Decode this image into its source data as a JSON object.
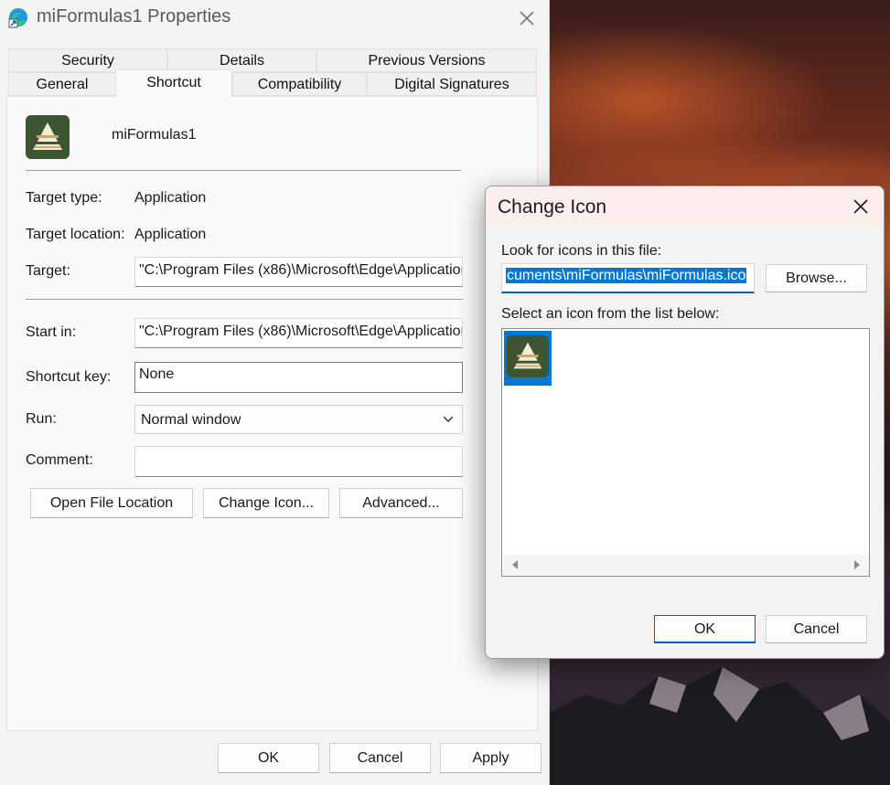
{
  "properties": {
    "title": "miFormulas1 Properties",
    "tabs_row1": [
      "Security",
      "Details",
      "Previous Versions"
    ],
    "tabs_row2": [
      "General",
      "Shortcut",
      "Compatibility",
      "Digital Signatures"
    ],
    "active_tab": "Shortcut",
    "shortcut_name": "miFormulas1",
    "target_type_label": "Target type:",
    "target_type_value": "Application",
    "target_location_label": "Target location:",
    "target_location_value": "Application",
    "target_label": "Target:",
    "target_value": "\"C:\\Program Files (x86)\\Microsoft\\Edge\\Application",
    "start_in_label": "Start in:",
    "start_in_value": "\"C:\\Program Files (x86)\\Microsoft\\Edge\\Application",
    "shortcut_key_label": "Shortcut key:",
    "shortcut_key_value": "None",
    "run_label": "Run:",
    "run_value": "Normal window",
    "comment_label": "Comment:",
    "comment_value": "",
    "open_file_location": "Open File Location",
    "change_icon": "Change Icon...",
    "advanced": "Advanced...",
    "ok": "OK",
    "cancel": "Cancel",
    "apply": "Apply"
  },
  "change_icon_dialog": {
    "title": "Change Icon",
    "look_label": "Look for icons in this file:",
    "file_path": "cuments\\miFormulas\\miFormulas.ico",
    "browse": "Browse...",
    "select_label": "Select an icon from the list below:",
    "ok": "OK",
    "cancel": "Cancel"
  },
  "colors": {
    "accent": "#0078d4",
    "icon_bg": "#3d5531"
  }
}
